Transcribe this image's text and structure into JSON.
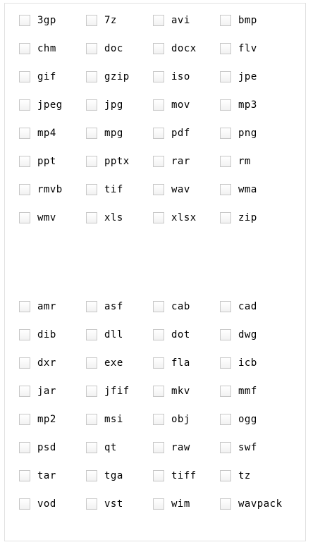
{
  "file_types_group_1": [
    "3gp",
    "7z",
    "avi",
    "bmp",
    "chm",
    "doc",
    "docx",
    "flv",
    "gif",
    "gzip",
    "iso",
    "jpe",
    "jpeg",
    "jpg",
    "mov",
    "mp3",
    "mp4",
    "mpg",
    "pdf",
    "png",
    "ppt",
    "pptx",
    "rar",
    "rm",
    "rmvb",
    "tif",
    "wav",
    "wma",
    "wmv",
    "xls",
    "xlsx",
    "zip"
  ],
  "file_types_group_2": [
    "amr",
    "asf",
    "cab",
    "cad",
    "dib",
    "dll",
    "dot",
    "dwg",
    "dxr",
    "exe",
    "fla",
    "icb",
    "jar",
    "jfif",
    "mkv",
    "mmf",
    "mp2",
    "msi",
    "obj",
    "ogg",
    "psd",
    "qt",
    "raw",
    "swf",
    "tar",
    "tga",
    "tiff",
    "tz",
    "vod",
    "vst",
    "wim",
    "wavpack"
  ],
  "colors": {
    "background": "#ffffff",
    "checkbox_border": "#c7c7c7",
    "text": "#000000"
  }
}
